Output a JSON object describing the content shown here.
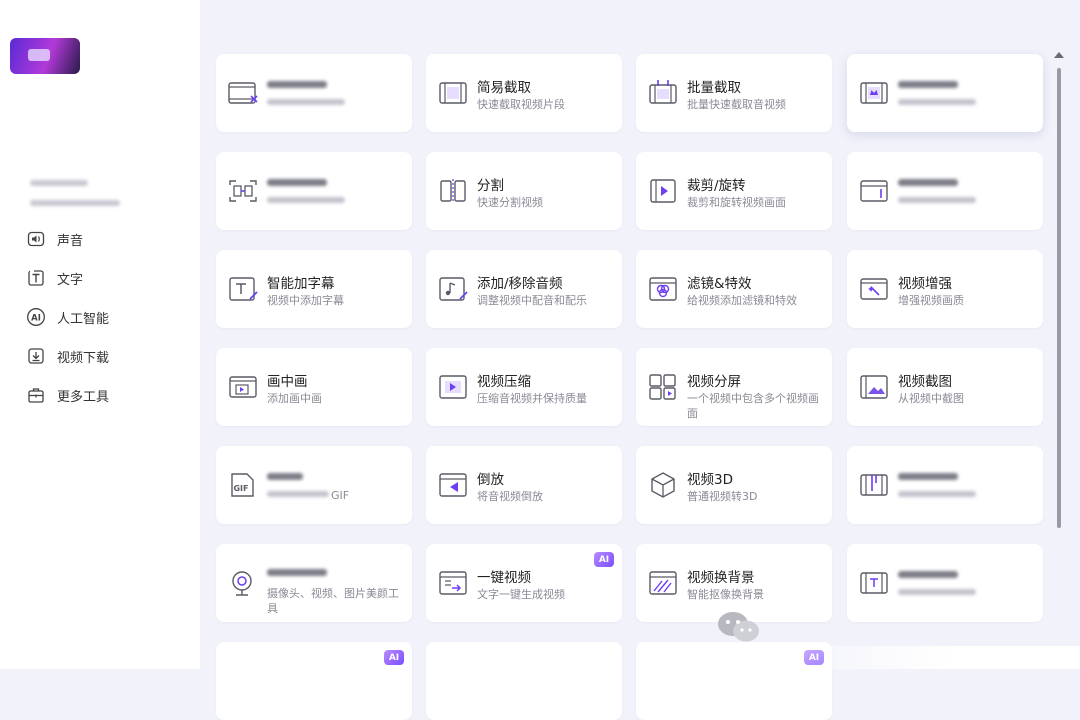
{
  "sidebar": {
    "items": [
      {
        "label": "声音",
        "icon": "sound-icon"
      },
      {
        "label": "文字",
        "icon": "text-icon"
      },
      {
        "label": "人工智能",
        "icon": "ai-icon"
      },
      {
        "label": "视频下载",
        "icon": "download-icon"
      },
      {
        "label": "更多工具",
        "icon": "toolbox-icon"
      }
    ]
  },
  "cards": [
    {
      "title": "简易截取",
      "desc": "快速截取视频片段"
    },
    {
      "title": "批量截取",
      "desc": "批量快速截取音视频"
    },
    {
      "title": "分割",
      "desc": "快速分割视频"
    },
    {
      "title": "裁剪/旋转",
      "desc": "裁剪和旋转视频画面"
    },
    {
      "title": "智能加字幕",
      "desc": "视频中添加字幕"
    },
    {
      "title": "添加/移除音频",
      "desc": "调整视频中配音和配乐"
    },
    {
      "title": "滤镜&特效",
      "desc": "给视频添加滤镜和特效"
    },
    {
      "title": "视频增强",
      "desc": "增强视频画质"
    },
    {
      "title": "画中画",
      "desc": "添加画中画"
    },
    {
      "title": "视频压缩",
      "desc": "压缩音视频并保持质量"
    },
    {
      "title": "视频分屏",
      "desc": "一个视频中包含多个视频画面"
    },
    {
      "title": "视频截图",
      "desc": "从视频中截图"
    },
    {
      "title": "倒放",
      "desc": "将音视频倒放"
    },
    {
      "title": "视频3D",
      "desc": "普通视频转3D"
    },
    {
      "title": "一键视频",
      "desc": "文字一键生成视频"
    },
    {
      "title": "视频换背景",
      "desc": "智能抠像换背景"
    }
  ],
  "blurred_fragments": {
    "gif_desc_tail": "GIF",
    "beauty_desc": "摄像头、视频、图片美颜工具"
  },
  "badges": {
    "ai": "AI"
  },
  "colors": {
    "accent": "#6c3ff5",
    "icon_stroke": "#5a5a66",
    "background": "#f1f2fa"
  }
}
